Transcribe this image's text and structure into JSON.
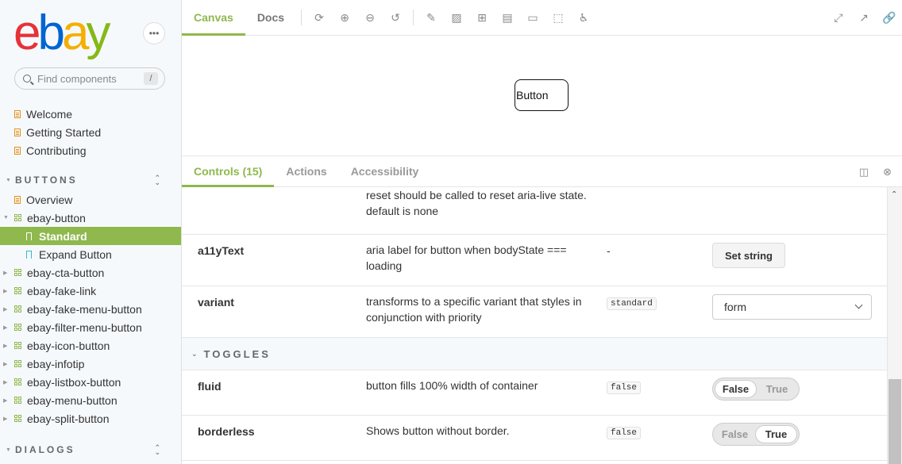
{
  "sidebar": {
    "logo": {
      "e": "e",
      "b": "b",
      "a": "a",
      "y": "y"
    },
    "more_icon": "ellipsis-icon",
    "search_placeholder": "Find components",
    "search_shortcut": "/",
    "top_items": [
      "Welcome",
      "Getting Started",
      "Contributing"
    ],
    "sections": [
      {
        "title": "BUTTONS",
        "items": [
          {
            "label": "Overview",
            "type": "doc"
          },
          {
            "label": "ebay-button",
            "type": "component",
            "expanded": true
          },
          {
            "label": "Standard",
            "type": "story",
            "selected": true
          },
          {
            "label": "Expand Button",
            "type": "story"
          },
          {
            "label": "ebay-cta-button",
            "type": "component"
          },
          {
            "label": "ebay-fake-link",
            "type": "component"
          },
          {
            "label": "ebay-fake-menu-button",
            "type": "component"
          },
          {
            "label": "ebay-filter-menu-button",
            "type": "component"
          },
          {
            "label": "ebay-icon-button",
            "type": "component"
          },
          {
            "label": "ebay-infotip",
            "type": "component"
          },
          {
            "label": "ebay-listbox-button",
            "type": "component"
          },
          {
            "label": "ebay-menu-button",
            "type": "component"
          },
          {
            "label": "ebay-split-button",
            "type": "component"
          }
        ]
      },
      {
        "title": "DIALOGS"
      }
    ]
  },
  "toolbar": {
    "tabs": [
      "Canvas",
      "Docs"
    ],
    "active_tab": "Canvas"
  },
  "canvas": {
    "preview_button_label": "Button"
  },
  "panel": {
    "tabs": [
      "Controls (15)",
      "Actions",
      "Accessibility"
    ],
    "active_tab": "Controls (15)"
  },
  "controls": {
    "partial_desc": "reset should be called to reset aria-live state. default is none",
    "rows": [
      {
        "name": "a11yText",
        "desc": "aria label for button when bodyState === loading",
        "default": "-",
        "control": "Set string"
      },
      {
        "name": "variant",
        "desc": "transforms to a specific variant that styles in conjunction with priority",
        "default": "standard",
        "control": "form"
      }
    ],
    "toggles_title": "TOGGLES",
    "toggles": [
      {
        "name": "fluid",
        "desc": "button fills 100% width of container",
        "default": "false",
        "off_label": "False",
        "on_label": "True",
        "value": false
      },
      {
        "name": "borderless",
        "desc": "Shows button without border.",
        "default": "false",
        "off_label": "False",
        "on_label": "True",
        "value": true
      }
    ]
  },
  "colors": {
    "accent": "#8fb84d",
    "sidebar_bg": "#f6f9fc"
  }
}
